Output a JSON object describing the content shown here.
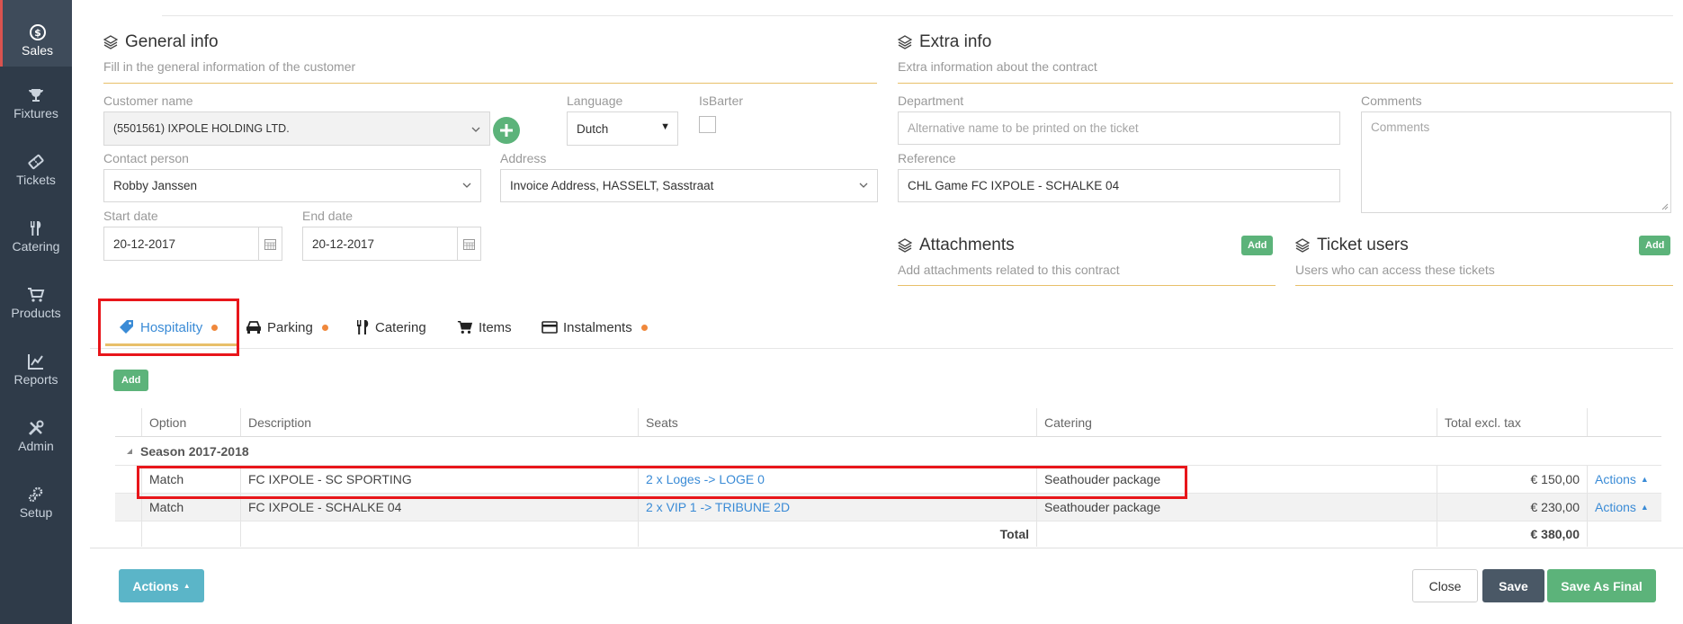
{
  "sidebar": {
    "items": [
      {
        "label": "Sales",
        "icon": "dollar-icon"
      },
      {
        "label": "Fixtures",
        "icon": "trophy-icon"
      },
      {
        "label": "Tickets",
        "icon": "ticket-icon"
      },
      {
        "label": "Catering",
        "icon": "cutlery-icon"
      },
      {
        "label": "Products",
        "icon": "cart-icon"
      },
      {
        "label": "Reports",
        "icon": "chart-icon"
      },
      {
        "label": "Admin",
        "icon": "tools-icon"
      },
      {
        "label": "Setup",
        "icon": "gears-icon"
      }
    ]
  },
  "general": {
    "title": "General info",
    "subtitle": "Fill in the general information of the customer",
    "customer_label": "Customer name",
    "customer_value": "(5501561) IXPOLE HOLDING LTD.",
    "language_label": "Language",
    "language_value": "Dutch",
    "isbarter_label": "IsBarter",
    "contact_label": "Contact person",
    "contact_value": "Robby Janssen",
    "address_label": "Address",
    "address_value": "Invoice Address, HASSELT, Sasstraat",
    "start_label": "Start date",
    "start_value": "20-12-2017",
    "end_label": "End date",
    "end_value": "20-12-2017"
  },
  "extra": {
    "title": "Extra info",
    "subtitle": "Extra information about the contract",
    "department_label": "Department",
    "department_placeholder": "Alternative name to be printed on the ticket",
    "comments_label": "Comments",
    "comments_placeholder": "Comments",
    "reference_label": "Reference",
    "reference_value": "CHL Game FC IXPOLE - SCHALKE 04"
  },
  "attachments": {
    "title": "Attachments",
    "subtitle": "Add attachments related to this contract",
    "add_label": "Add"
  },
  "ticket_users": {
    "title": "Ticket users",
    "subtitle": "Users who can access these tickets",
    "add_label": "Add"
  },
  "tabs": [
    {
      "label": "Hospitality",
      "dot": true
    },
    {
      "label": "Parking",
      "dot": true
    },
    {
      "label": "Catering",
      "dot": false
    },
    {
      "label": "Items",
      "dot": false
    },
    {
      "label": "Instalments",
      "dot": true
    }
  ],
  "grid": {
    "add_label": "Add",
    "columns": [
      "Option",
      "Description",
      "Seats",
      "Catering",
      "Total excl. tax"
    ],
    "group": "Season 2017-2018",
    "rows": [
      {
        "option": "Match",
        "description": "FC IXPOLE - SC SPORTING",
        "seats": "2 x Loges -> LOGE 0",
        "catering": "Seathouder package",
        "total": "€ 150,00",
        "actions": "Actions"
      },
      {
        "option": "Match",
        "description": "FC IXPOLE - SCHALKE 04",
        "seats": "2 x VIP 1 -> TRIBUNE 2D",
        "catering": "Seathouder package",
        "total": "€ 230,00",
        "actions": "Actions"
      }
    ],
    "total_label": "Total",
    "total_value": "€ 380,00"
  },
  "footer": {
    "actions_label": "Actions",
    "close_label": "Close",
    "save_label": "Save",
    "save_final_label": "Save As Final"
  },
  "colors": {
    "sidebar": "#2f3b49",
    "accent_blue": "#3a8bd6",
    "green": "#5cb37a",
    "highlight_red": "#e8161b",
    "orange_dot": "#f0883c"
  }
}
